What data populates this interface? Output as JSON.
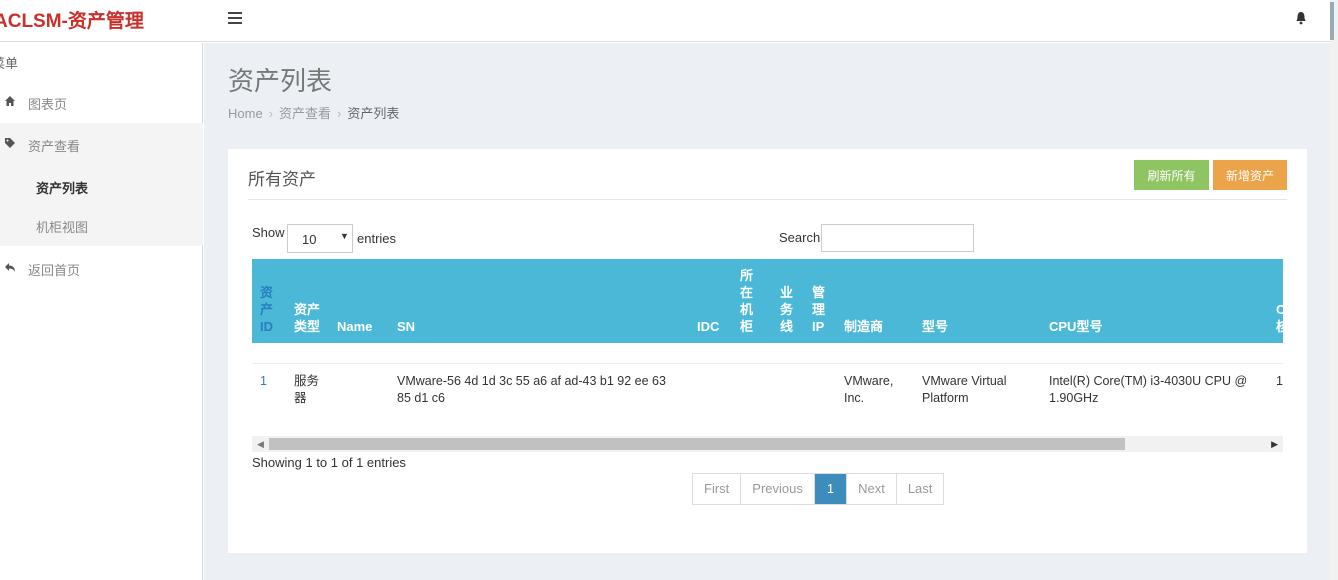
{
  "header": {
    "brand": "ACLSM-资产管理",
    "menu_icon": "hamburger-icon",
    "bell_icon": "bell-icon"
  },
  "sidebar": {
    "menu_label": "菜单",
    "dashboard": {
      "label": "图表页",
      "icon": "home-icon"
    },
    "assets": {
      "label": "资产查看",
      "icon": "tag-icon",
      "children": [
        {
          "label": "资产列表"
        },
        {
          "label": "机柜视图"
        }
      ]
    },
    "back": {
      "label": "返回首页",
      "icon": "reply-icon"
    }
  },
  "page": {
    "title": "资产列表",
    "breadcrumb": [
      "Home",
      "资产查看",
      "资产列表"
    ]
  },
  "box": {
    "title": "所有资产",
    "refresh_button": "刷新所有",
    "add_button": "新增资产"
  },
  "datatable": {
    "show_label": "Show",
    "length_value": "10",
    "entries_label": "entries",
    "search_label": "Search:",
    "search_value": "",
    "info": "Showing 1 to 1 of 1 entries",
    "columns": [
      "资产ID",
      "资产类型",
      "Name",
      "SN",
      "IDC",
      "所在机柜",
      "业务线",
      "管理IP",
      "制造商",
      "型号",
      "CPU型号",
      "C核"
    ],
    "rows": [
      {
        "id": "1",
        "type": "服务器",
        "name": "",
        "sn": "VMware-56 4d 1d 3c 55 a6 af ad-43 b1 92 ee 63 85 d1 c6",
        "idc": "",
        "cabinet": "",
        "business": "",
        "ip": "",
        "maker": "VMware, Inc.",
        "model": "VMware Virtual Platform",
        "cpu": "Intel(R) Core(TM) i3-4030U CPU @ 1.90GHz",
        "cores": "1"
      }
    ],
    "pagination": {
      "first": "First",
      "previous": "Previous",
      "current": "1",
      "next": "Next",
      "last": "Last"
    }
  },
  "colors": {
    "brand": "#c9302c",
    "table_header": "#4bb8d8",
    "refresh": "#8fc462",
    "add": "#eba44a",
    "page_active": "#3c8dbc"
  }
}
